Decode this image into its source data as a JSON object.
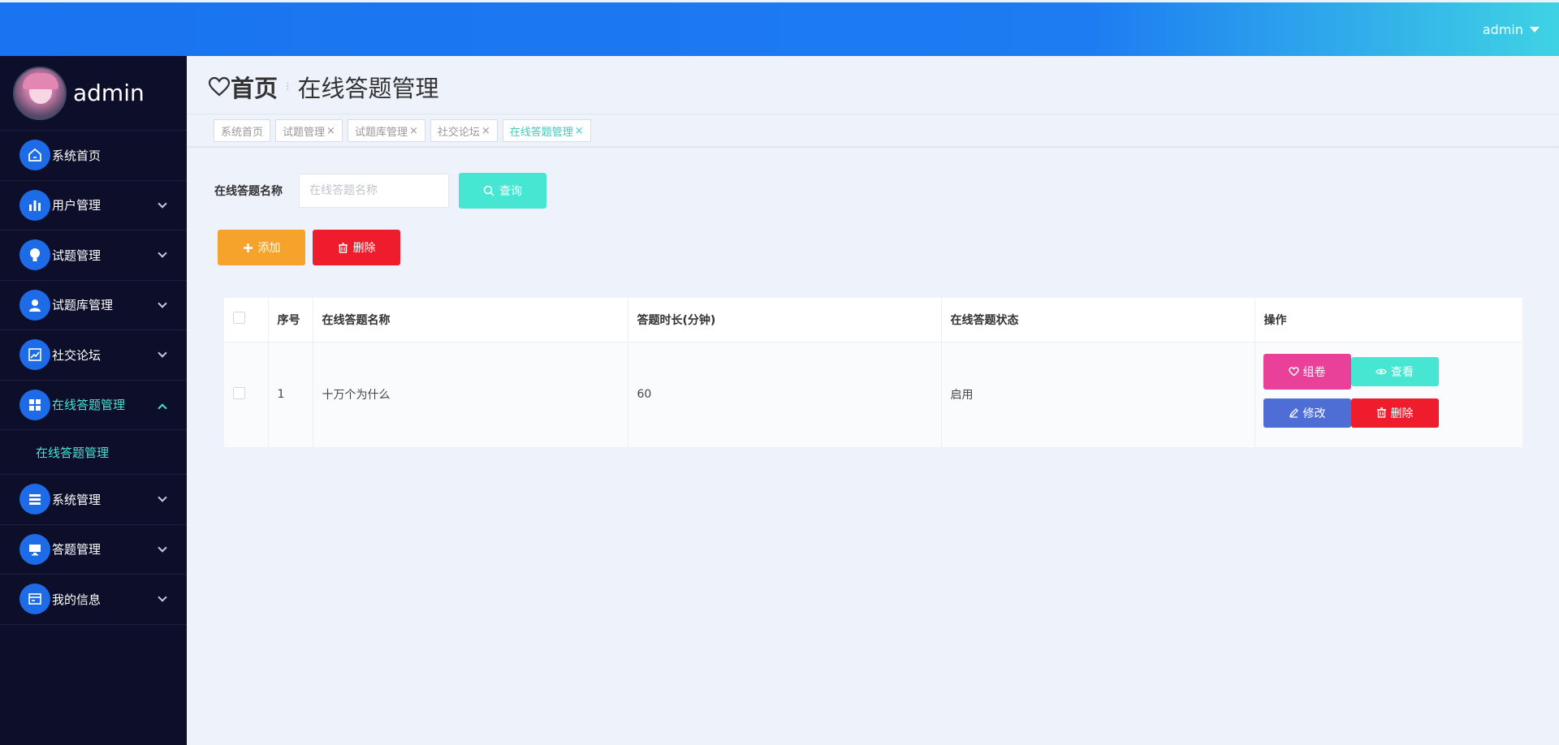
{
  "topbar": {
    "user": "admin"
  },
  "sidebar": {
    "username": "admin",
    "items": [
      {
        "label": "系统首页",
        "icon": "home-icon"
      },
      {
        "label": "用户管理",
        "icon": "bar-chart-icon"
      },
      {
        "label": "试题管理",
        "icon": "lightbulb-icon"
      },
      {
        "label": "试题库管理",
        "icon": "user-icon"
      },
      {
        "label": "社交论坛",
        "icon": "trend-chart-icon"
      },
      {
        "label": "在线答题管理",
        "icon": "grid-icon"
      },
      {
        "label": "系统管理",
        "icon": "list-icon"
      },
      {
        "label": "答题管理",
        "icon": "monitor-icon"
      },
      {
        "label": "我的信息",
        "icon": "card-icon"
      }
    ],
    "submenu": "在线答题管理"
  },
  "breadcrumb": {
    "home": "首页",
    "current": "在线答题管理"
  },
  "tabs": [
    {
      "label": "系统首页",
      "close": ""
    },
    {
      "label": "试题管理",
      "close": "×"
    },
    {
      "label": "试题库管理",
      "close": "×"
    },
    {
      "label": "社交论坛",
      "close": "×"
    },
    {
      "label": "在线答题管理",
      "close": "×"
    }
  ],
  "search": {
    "label": "在线答题名称",
    "placeholder": "在线答题名称",
    "button": "查询"
  },
  "actions": {
    "add": "添加",
    "delete": "删除"
  },
  "table": {
    "headers": [
      "",
      "序号",
      "在线答题名称",
      "答题时长(分钟)",
      "在线答题状态",
      "操作"
    ],
    "rows": [
      {
        "index": "1",
        "name": "十万个为什么",
        "duration": "60",
        "status": "启用"
      }
    ],
    "ops": {
      "zujuan": "组卷",
      "view": "查看",
      "edit": "修改",
      "delete": "删除"
    }
  },
  "colors": {
    "topbar": "#1a73f0",
    "sidebar": "#0d0f2a",
    "accent": "#47e6d3",
    "add": "#f5a32a",
    "danger": "#ef1c2d",
    "pink": "#e9409a",
    "edit": "#4e6ed6"
  }
}
